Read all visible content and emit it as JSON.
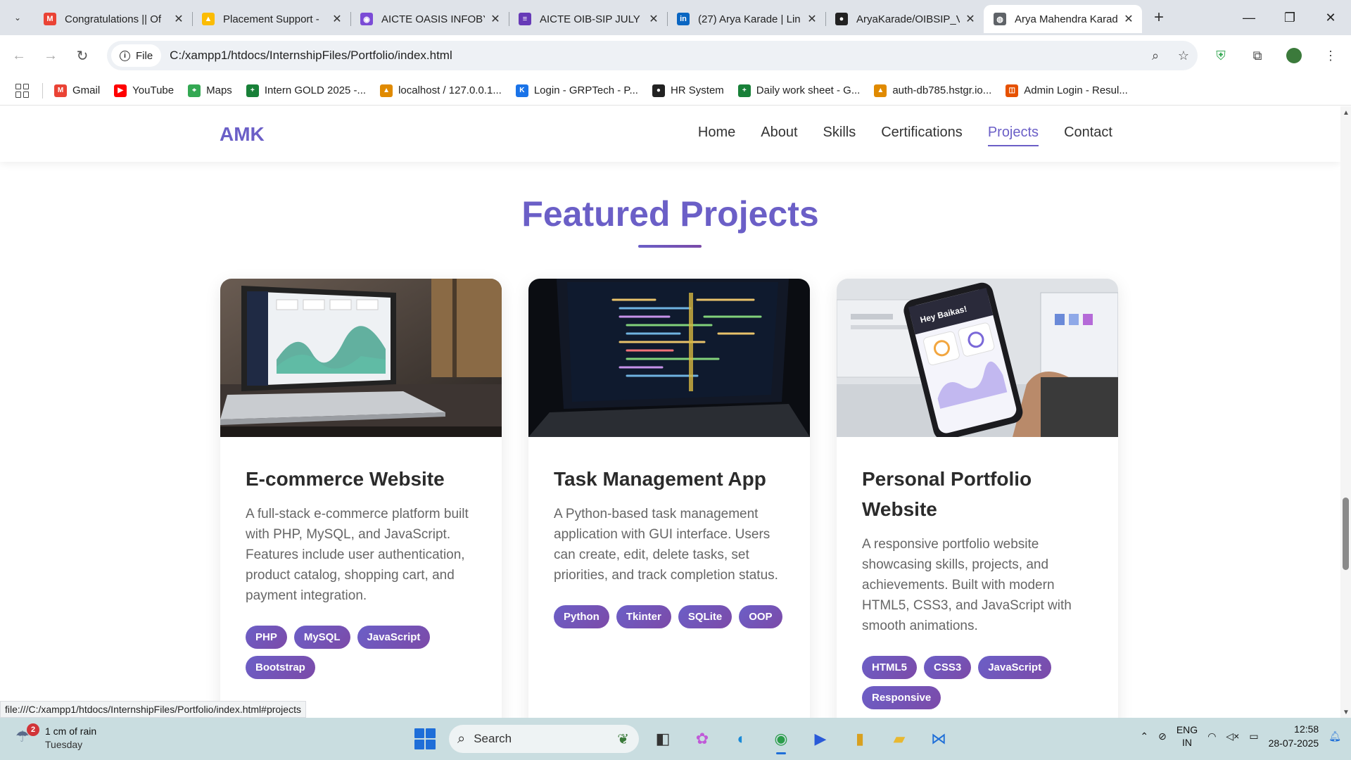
{
  "browser": {
    "tabs": [
      {
        "title": "Congratulations || Of",
        "icon": "gmail-icon",
        "color": "#ea4335",
        "glyph": "M"
      },
      {
        "title": "Placement Support -",
        "icon": "google-drive-icon",
        "color": "#fbbc04",
        "glyph": "▲"
      },
      {
        "title": "AICTE OASIS INFOBY",
        "icon": "chat-icon",
        "color": "#7b4bd6",
        "glyph": "◉"
      },
      {
        "title": "AICTE OIB-SIP JULY",
        "icon": "google-forms-icon",
        "color": "#673ab7",
        "glyph": "≡"
      },
      {
        "title": "(27) Arya Karade | Lin",
        "icon": "linkedin-icon",
        "color": "#0a66c2",
        "glyph": "in"
      },
      {
        "title": "AryaKarade/OIBSIP_V",
        "icon": "github-icon",
        "color": "#222222",
        "glyph": "●"
      },
      {
        "title": "Arya Mahendra Karad",
        "icon": "globe-icon",
        "color": "#5f6368",
        "glyph": "◍",
        "active": true
      }
    ],
    "file_chip": "File",
    "url": "C:/xampp1/htdocs/InternshipFiles/Portfolio/index.html",
    "bookmarks": [
      {
        "label": "Gmail",
        "icon": "gmail-icon",
        "color": "#ea4335",
        "glyph": "M"
      },
      {
        "label": "YouTube",
        "icon": "youtube-icon",
        "color": "#ff0000",
        "glyph": "▶"
      },
      {
        "label": "Maps",
        "icon": "maps-icon",
        "color": "#34a853",
        "glyph": "⌖"
      },
      {
        "label": "Intern GOLD 2025 -...",
        "icon": "sheets-icon",
        "color": "#188038",
        "glyph": "+"
      },
      {
        "label": "localhost / 127.0.0.1...",
        "icon": "phpmyadmin-icon",
        "color": "#e08a00",
        "glyph": "▲"
      },
      {
        "label": "Login - GRPTech - P...",
        "icon": "login-icon",
        "color": "#1a73e8",
        "glyph": "K"
      },
      {
        "label": "HR System",
        "icon": "github-icon",
        "color": "#222222",
        "glyph": "●"
      },
      {
        "label": "Daily work sheet - G...",
        "icon": "sheets-icon",
        "color": "#188038",
        "glyph": "+"
      },
      {
        "label": "auth-db785.hstgr.io...",
        "icon": "phpmyadmin-icon",
        "color": "#e08a00",
        "glyph": "▲"
      },
      {
        "label": "Admin Login - Resul...",
        "icon": "admin-icon",
        "color": "#e65100",
        "glyph": "◫"
      }
    ],
    "status_url": "file:///C:/xampp1/htdocs/InternshipFiles/Portfolio/index.html#projects"
  },
  "site": {
    "logo": "AMK",
    "nav": [
      "Home",
      "About",
      "Skills",
      "Certifications",
      "Projects",
      "Contact"
    ],
    "active_nav": "Projects",
    "section_title": "Featured Projects",
    "accent_color": "#6b5fc7",
    "projects": [
      {
        "title": "E-commerce Website",
        "description": "A full-stack e-commerce platform built with PHP, MySQL, and JavaScript. Features include user authentication, product catalog, shopping cart, and payment integration.",
        "tags": [
          "PHP",
          "MySQL",
          "JavaScript",
          "Bootstrap"
        ],
        "image": "laptop-dashboard-image"
      },
      {
        "title": "Task Management App",
        "description": "A Python-based task management application with GUI interface. Users can create, edit, delete tasks, set priorities, and track completion status.",
        "tags": [
          "Python",
          "Tkinter",
          "SQLite",
          "OOP"
        ],
        "image": "laptop-code-image"
      },
      {
        "title": "Personal Portfolio Website",
        "description": "A responsive portfolio website showcasing skills, projects, and achievements. Built with modern HTML5, CSS3, and JavaScript with smooth animations.",
        "tags": [
          "HTML5",
          "CSS3",
          "JavaScript",
          "Responsive"
        ],
        "image": "phone-app-image"
      }
    ]
  },
  "taskbar": {
    "weather_text": "1 cm of rain",
    "weather_day": "Tuesday",
    "weather_badge": "2",
    "search_label": "Search",
    "lang_top": "ENG",
    "lang_bottom": "IN",
    "time": "12:58",
    "date": "28-07-2025"
  }
}
